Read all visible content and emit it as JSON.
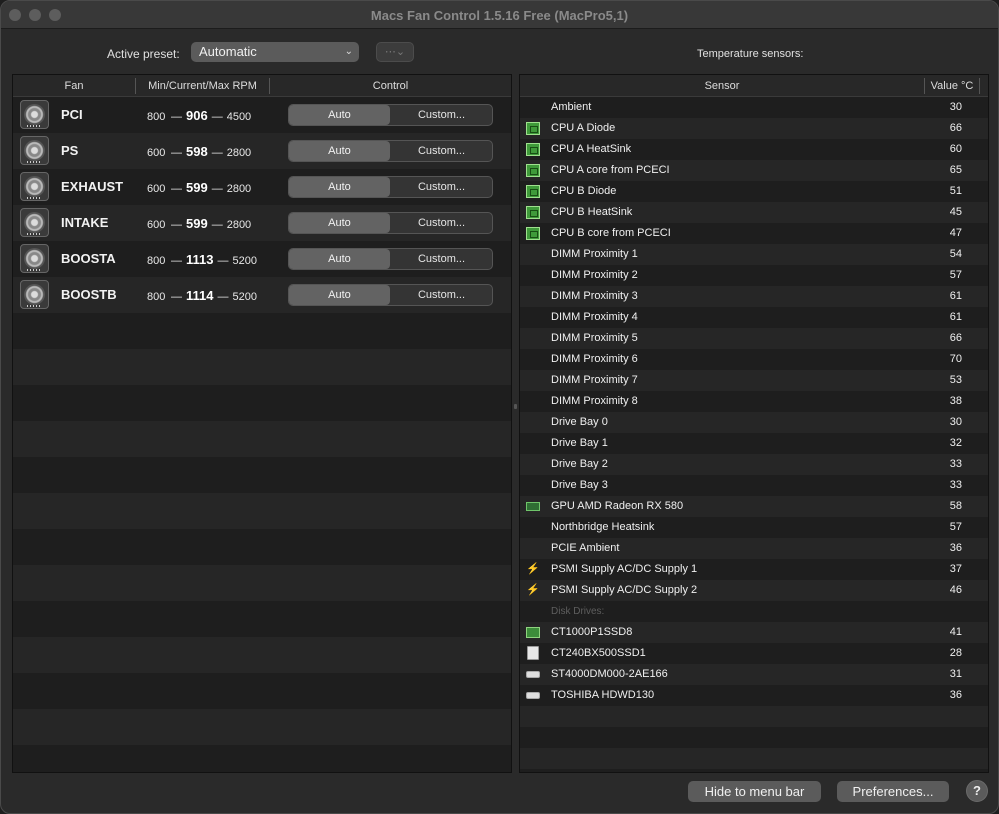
{
  "window": {
    "title": "Macs Fan Control 1.5.16 Free (MacPro5,1)"
  },
  "preset": {
    "label": "Active preset:",
    "value": "Automatic",
    "options_icon": "ellipsis-icon"
  },
  "temperature_sensors_label": "Temperature sensors:",
  "fan_table": {
    "headers": {
      "fan": "Fan",
      "rpm": "Min/Current/Max RPM",
      "control": "Control"
    },
    "fans": [
      {
        "name": "PCI",
        "min": "800",
        "current": "906",
        "max": "4500",
        "auto": "Auto",
        "custom": "Custom..."
      },
      {
        "name": "PS",
        "min": "600",
        "current": "598",
        "max": "2800",
        "auto": "Auto",
        "custom": "Custom..."
      },
      {
        "name": "EXHAUST",
        "min": "600",
        "current": "599",
        "max": "2800",
        "auto": "Auto",
        "custom": "Custom..."
      },
      {
        "name": "INTAKE",
        "min": "600",
        "current": "599",
        "max": "2800",
        "auto": "Auto",
        "custom": "Custom..."
      },
      {
        "name": "BOOSTA",
        "min": "800",
        "current": "1113",
        "max": "5200",
        "auto": "Auto",
        "custom": "Custom..."
      },
      {
        "name": "BOOSTB",
        "min": "800",
        "current": "1114",
        "max": "5200",
        "auto": "Auto",
        "custom": "Custom..."
      }
    ],
    "dash": "—"
  },
  "sensor_table": {
    "headers": {
      "sensor": "Sensor",
      "value": "Value °C"
    },
    "sensors": [
      {
        "name": "Ambient",
        "value": "30",
        "icon": ""
      },
      {
        "name": "CPU A Diode",
        "value": "66",
        "icon": "cpu"
      },
      {
        "name": "CPU A HeatSink",
        "value": "60",
        "icon": "cpu"
      },
      {
        "name": "CPU A core from PCECI",
        "value": "65",
        "icon": "cpu"
      },
      {
        "name": "CPU B Diode",
        "value": "51",
        "icon": "cpu"
      },
      {
        "name": "CPU B HeatSink",
        "value": "45",
        "icon": "cpu"
      },
      {
        "name": "CPU B core from PCECI",
        "value": "47",
        "icon": "cpu"
      },
      {
        "name": "DIMM Proximity 1",
        "value": "54",
        "icon": ""
      },
      {
        "name": "DIMM Proximity 2",
        "value": "57",
        "icon": ""
      },
      {
        "name": "DIMM Proximity 3",
        "value": "61",
        "icon": ""
      },
      {
        "name": "DIMM Proximity 4",
        "value": "61",
        "icon": ""
      },
      {
        "name": "DIMM Proximity 5",
        "value": "66",
        "icon": ""
      },
      {
        "name": "DIMM Proximity 6",
        "value": "70",
        "icon": ""
      },
      {
        "name": "DIMM Proximity 7",
        "value": "53",
        "icon": ""
      },
      {
        "name": "DIMM Proximity 8",
        "value": "38",
        "icon": ""
      },
      {
        "name": "Drive Bay 0",
        "value": "30",
        "icon": ""
      },
      {
        "name": "Drive Bay 1",
        "value": "32",
        "icon": ""
      },
      {
        "name": "Drive Bay 2",
        "value": "33",
        "icon": ""
      },
      {
        "name": "Drive Bay 3",
        "value": "33",
        "icon": ""
      },
      {
        "name": "GPU AMD Radeon RX 580",
        "value": "58",
        "icon": "gpu"
      },
      {
        "name": "Northbridge Heatsink",
        "value": "57",
        "icon": ""
      },
      {
        "name": "PCIE Ambient",
        "value": "36",
        "icon": ""
      },
      {
        "name": "PSMI Supply AC/DC Supply 1",
        "value": "37",
        "icon": "bolt"
      },
      {
        "name": "PSMI Supply AC/DC Supply 2",
        "value": "46",
        "icon": "bolt"
      },
      {
        "name": "Disk Drives:",
        "value": "",
        "icon": "",
        "section": true
      },
      {
        "name": "CT1000P1SSD8",
        "value": "41",
        "icon": "ssd-m2"
      },
      {
        "name": "CT240BX500SSD1",
        "value": "28",
        "icon": "ssd"
      },
      {
        "name": "ST4000DM000-2AE166",
        "value": "31",
        "icon": "hdd"
      },
      {
        "name": "TOSHIBA HDWD130",
        "value": "36",
        "icon": "hdd"
      }
    ]
  },
  "footer": {
    "hide_button": "Hide to menu bar",
    "preferences_button": "Preferences...",
    "help_button": "?"
  }
}
